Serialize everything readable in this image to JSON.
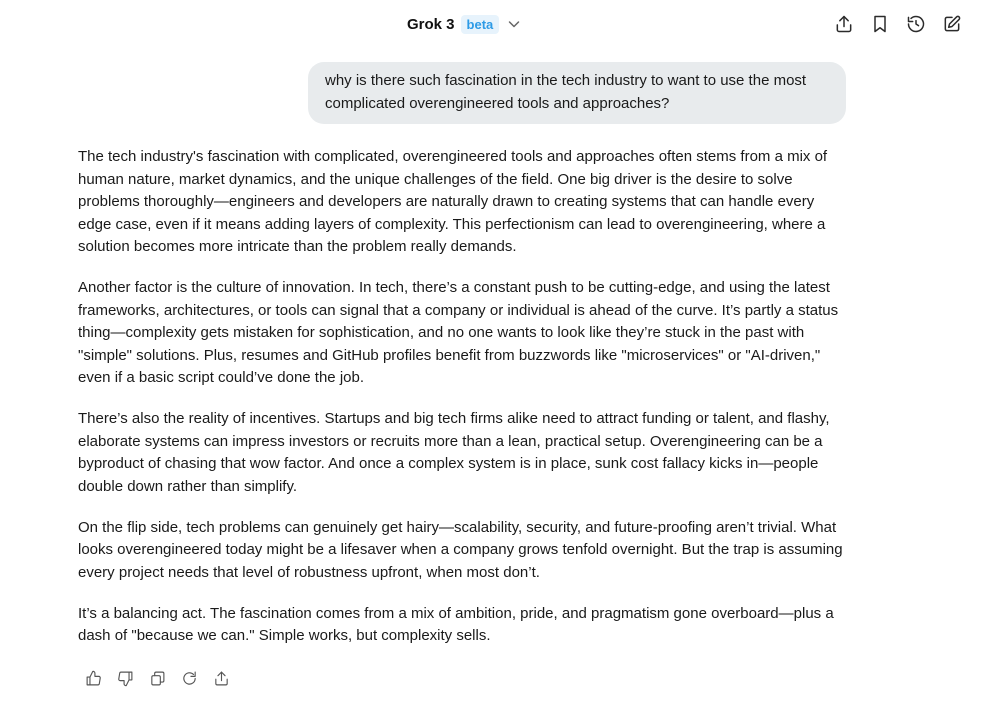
{
  "header": {
    "model_name": "Grok 3",
    "badge": "beta",
    "icons": [
      "chevron-down-icon",
      "share-icon",
      "bookmark-icon",
      "history-icon",
      "new-chat-icon"
    ]
  },
  "conversation": {
    "user_message": "why is there such fascination in the tech industry to want to use the most complicated overengineered tools and approaches?",
    "assistant_paragraphs": [
      "The tech industry's fascination with complicated, overengineered tools and approaches often stems from a mix of human nature, market dynamics, and the unique challenges of the field. One big driver is the desire to solve problems thoroughly—engineers and developers are naturally drawn to creating systems that can handle every edge case, even if it means adding layers of complexity. This perfectionism can lead to overengineering, where a solution becomes more intricate than the problem really demands.",
      "Another factor is the culture of innovation. In tech, there’s a constant push to be cutting-edge, and using the latest frameworks, architectures, or tools can signal that a company or individual is ahead of the curve. It’s partly a status thing—complexity gets mistaken for sophistication, and no one wants to look like they’re stuck in the past with \"simple\" solutions. Plus, resumes and GitHub profiles benefit from buzzwords like \"microservices\" or \"AI-driven,\" even if a basic script could’ve done the job.",
      "There’s also the reality of incentives. Startups and big tech firms alike need to attract funding or talent, and flashy, elaborate systems can impress investors or recruits more than a lean, practical setup. Overengineering can be a byproduct of chasing that wow factor. And once a complex system is in place, sunk cost fallacy kicks in—people double down rather than simplify.",
      "On the flip side, tech problems can genuinely get hairy—scalability, security, and future-proofing aren’t trivial. What looks overengineered today might be a lifesaver when a company grows tenfold overnight. But the trap is assuming every project needs that level of robustness upfront, when most don’t.",
      "It’s a balancing act. The fascination comes from a mix of ambition, pride, and pragmatism gone overboard—plus a dash of \"because we can.\" Simple works, but complexity sells."
    ]
  },
  "response_actions": [
    "thumbs-up-icon",
    "thumbs-down-icon",
    "copy-icon",
    "regenerate-icon",
    "share-icon"
  ],
  "colors": {
    "badge_text": "#2e9be6",
    "badge_bg": "#e7f3fc",
    "user_bubble_bg": "#e8ebed",
    "text": "#1a1a1a"
  }
}
